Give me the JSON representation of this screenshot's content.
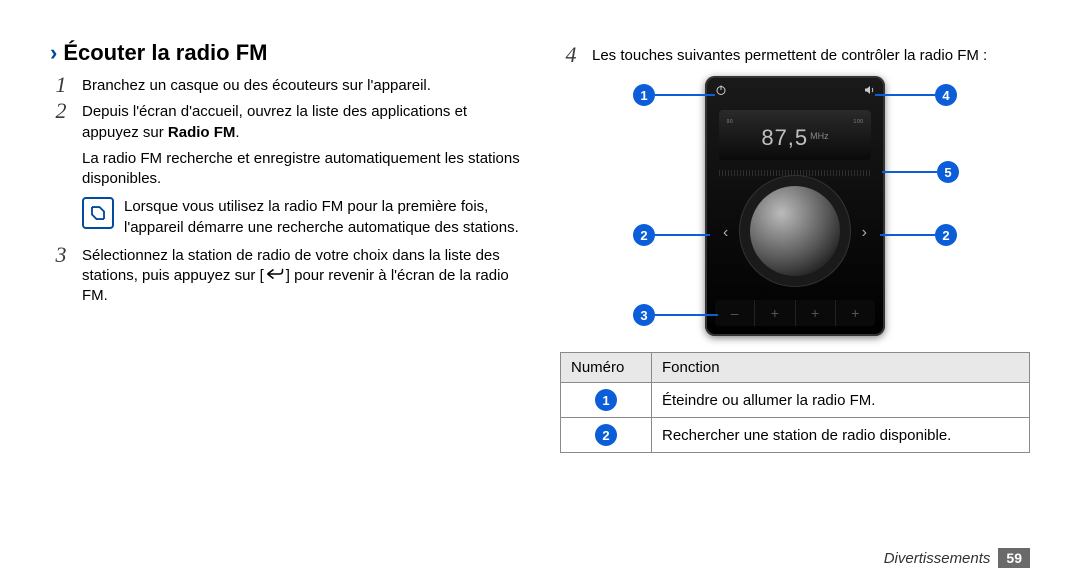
{
  "heading": "Écouter la radio FM",
  "steps": {
    "s1": {
      "num": "1",
      "text": "Branchez un casque ou des écouteurs sur l'appareil."
    },
    "s2": {
      "num": "2",
      "text_pre": "Depuis l'écran d'accueil, ouvrez la liste des applications et appuyez sur ",
      "bold": "Radio FM",
      "text_post": ".",
      "sub": "La radio FM recherche et enregistre automatiquement les stations disponibles."
    },
    "note": "Lorsque vous utilisez la radio FM pour la première fois, l'appareil démarre une recherche automatique des stations.",
    "s3": {
      "num": "3",
      "text_pre": "Sélectionnez la station de radio de votre choix dans la liste des stations, puis appuyez sur [",
      "text_post": "] pour revenir à l'écran de la radio FM."
    },
    "s4": {
      "num": "4",
      "text": "Les touches suivantes permettent de contrôler la radio FM :"
    }
  },
  "device": {
    "tick_left": "90",
    "tick_right": "100",
    "frequency": "87,5",
    "unit": "MHz"
  },
  "callouts": {
    "c1": "1",
    "c2": "2",
    "c3": "3",
    "c4": "4",
    "c5": "5"
  },
  "table": {
    "head_num": "Numéro",
    "head_func": "Fonction",
    "rows": [
      {
        "num": "1",
        "func": "Éteindre ou allumer la radio FM."
      },
      {
        "num": "2",
        "func": "Rechercher une station de radio disponible."
      }
    ]
  },
  "footer": {
    "section": "Divertissements",
    "page": "59"
  }
}
